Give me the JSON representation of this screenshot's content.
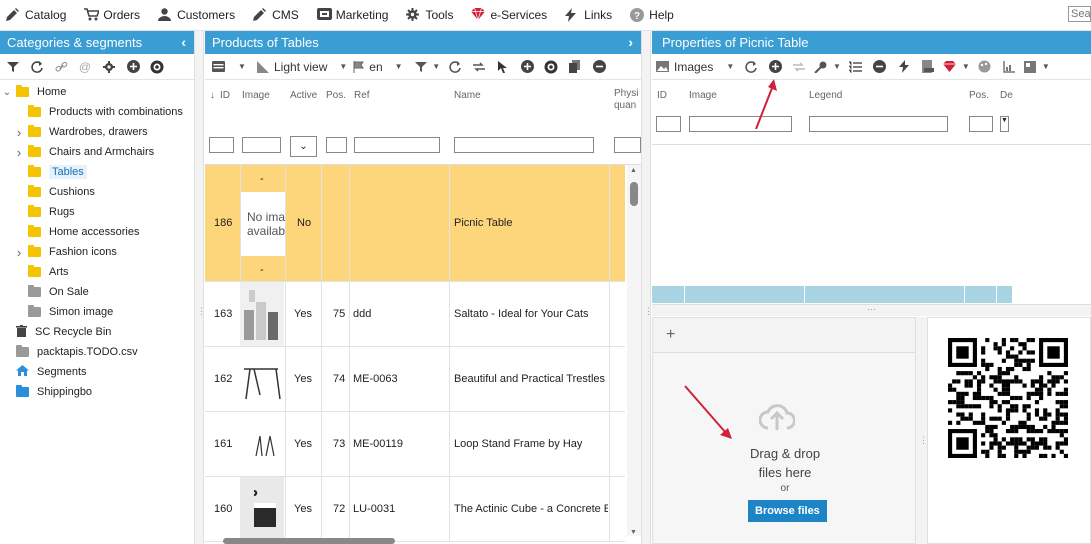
{
  "menu": [
    {
      "label": "Catalog",
      "icon": "pencil-icon"
    },
    {
      "label": "Orders",
      "icon": "cart-icon"
    },
    {
      "label": "Customers",
      "icon": "user-icon"
    },
    {
      "label": "CMS",
      "icon": "pencil-icon"
    },
    {
      "label": "Marketing",
      "icon": "ticket-icon"
    },
    {
      "label": "Tools",
      "icon": "gear-icon"
    },
    {
      "label": "e-Services",
      "icon": "gem-icon"
    },
    {
      "label": "Links",
      "icon": "bolt-icon"
    },
    {
      "label": "Help",
      "icon": "help-icon"
    }
  ],
  "search": {
    "placeholder": "Sea"
  },
  "left": {
    "title": "Categories & segments",
    "tree": [
      {
        "label": "Home",
        "level": 0,
        "expander": "v",
        "folder": "yellow"
      },
      {
        "label": "Products with combinations",
        "level": 1,
        "expander": "",
        "folder": "yellow"
      },
      {
        "label": "Wardrobes, drawers",
        "level": 1,
        "expander": ">",
        "folder": "yellow"
      },
      {
        "label": "Chairs and Armchairs",
        "level": 1,
        "expander": ">",
        "folder": "yellow"
      },
      {
        "label": "Tables",
        "level": 1,
        "expander": "",
        "folder": "yellow",
        "selected": true
      },
      {
        "label": "Cushions",
        "level": 1,
        "expander": "",
        "folder": "yellow"
      },
      {
        "label": "Rugs",
        "level": 1,
        "expander": "",
        "folder": "yellow"
      },
      {
        "label": "Home accessories",
        "level": 1,
        "expander": "",
        "folder": "yellow"
      },
      {
        "label": "Fashion icons",
        "level": 1,
        "expander": ">",
        "folder": "yellow"
      },
      {
        "label": "Arts",
        "level": 1,
        "expander": "",
        "folder": "yellow"
      },
      {
        "label": "On Sale",
        "level": 1,
        "expander": "",
        "folder": "grey"
      },
      {
        "label": "Simon image",
        "level": 1,
        "expander": "",
        "folder": "grey"
      },
      {
        "label": "SC Recycle Bin",
        "level": 0,
        "expander": "",
        "folder": "trash"
      },
      {
        "label": "packtapis.TODO.csv",
        "level": 0,
        "expander": "",
        "folder": "grey"
      },
      {
        "label": "Segments",
        "level": 0,
        "expander": "",
        "folder": "home"
      },
      {
        "label": "Shippingbo",
        "level": 0,
        "expander": "",
        "folder": "blue"
      }
    ]
  },
  "middle": {
    "title": "Products of Tables",
    "toolbar": {
      "view": "Light view",
      "lang": "en"
    },
    "columns": {
      "id": "ID",
      "image": "Image",
      "active": "Active",
      "pos": "Pos.",
      "ref": "Ref",
      "name": "Name",
      "phys": "Physi",
      "phys2": "quan"
    },
    "selected_row": {
      "id": "186",
      "dash": "-",
      "img_text1": "No ima",
      "img_text2": "availab",
      "active": "No",
      "pos": "",
      "ref": "",
      "name": "Picnic Table"
    },
    "rows": [
      {
        "id": "163",
        "active": "Yes",
        "pos": "75",
        "ref": "ddd",
        "name": "Saltato - Ideal for Your Cats"
      },
      {
        "id": "162",
        "active": "Yes",
        "pos": "74",
        "ref": "ME-0063",
        "name": "Beautiful and Practical Trestles"
      },
      {
        "id": "161",
        "active": "Yes",
        "pos": "73",
        "ref": "ME-00119",
        "name": "Loop Stand Frame by Hay"
      },
      {
        "id": "160",
        "active": "Yes",
        "pos": "72",
        "ref": "LU-0031",
        "name": "The Actinic Cube - a Concrete E"
      }
    ]
  },
  "right": {
    "title": "Properties of Picnic Table",
    "toolbar": {
      "images": "Images"
    },
    "columns": {
      "id": "ID",
      "image": "Image",
      "legend": "Legend",
      "pos": "Pos.",
      "de": "De"
    },
    "upload": {
      "plus": "+",
      "drag1": "Drag & drop",
      "drag2": "files here",
      "or": "or",
      "browse": "Browse files"
    }
  },
  "colors": {
    "accent": "#3a9dd4",
    "selected_row": "#fdd57a",
    "button": "#1d84c6",
    "arrow": "#d0213a"
  }
}
